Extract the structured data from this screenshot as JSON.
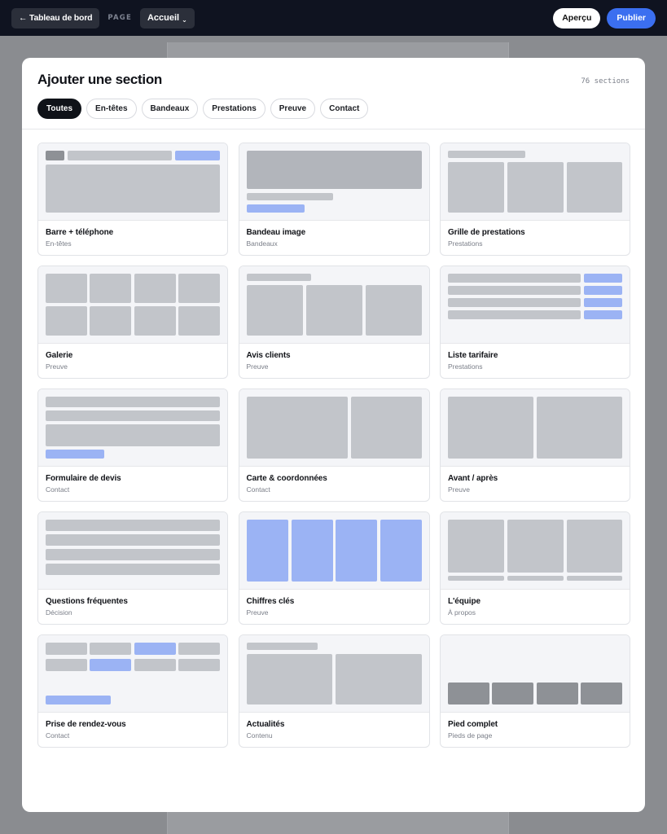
{
  "topbar": {
    "back_label": "← Tableau de bord",
    "page_label": "PAGE",
    "page_value": "Accueil",
    "preview_label": "Aperçu",
    "publish_label": "Publier"
  },
  "modal": {
    "title": "Ajouter une section",
    "count": "76 sections",
    "filters": [
      "Toutes",
      "En-têtes",
      "Bandeaux",
      "Prestations",
      "Preuve",
      "Contact"
    ],
    "active_filter": "Toutes"
  },
  "cards": [
    {
      "title": "Barre + téléphone",
      "category": "En-têtes"
    },
    {
      "title": "Bandeau image",
      "category": "Bandeaux"
    },
    {
      "title": "Grille de prestations",
      "category": "Prestations"
    },
    {
      "title": "Galerie",
      "category": "Preuve"
    },
    {
      "title": "Avis clients",
      "category": "Preuve"
    },
    {
      "title": "Liste tarifaire",
      "category": "Prestations"
    },
    {
      "title": "Formulaire de devis",
      "category": "Contact"
    },
    {
      "title": "Carte & coordonnées",
      "category": "Contact"
    },
    {
      "title": "Avant / après",
      "category": "Preuve"
    },
    {
      "title": "Questions fréquentes",
      "category": "Décision"
    },
    {
      "title": "Chiffres clés",
      "category": "Preuve"
    },
    {
      "title": "L'équipe",
      "category": "À propos"
    },
    {
      "title": "Prise de rendez-vous",
      "category": "Contact"
    },
    {
      "title": "Actualités",
      "category": "Contenu"
    },
    {
      "title": "Pied complet",
      "category": "Pieds de page"
    }
  ],
  "colors": {
    "topbar_bg": "#0f1320",
    "accent": "#3b6ff0",
    "placeholder_accent": "#9bb3f4"
  }
}
